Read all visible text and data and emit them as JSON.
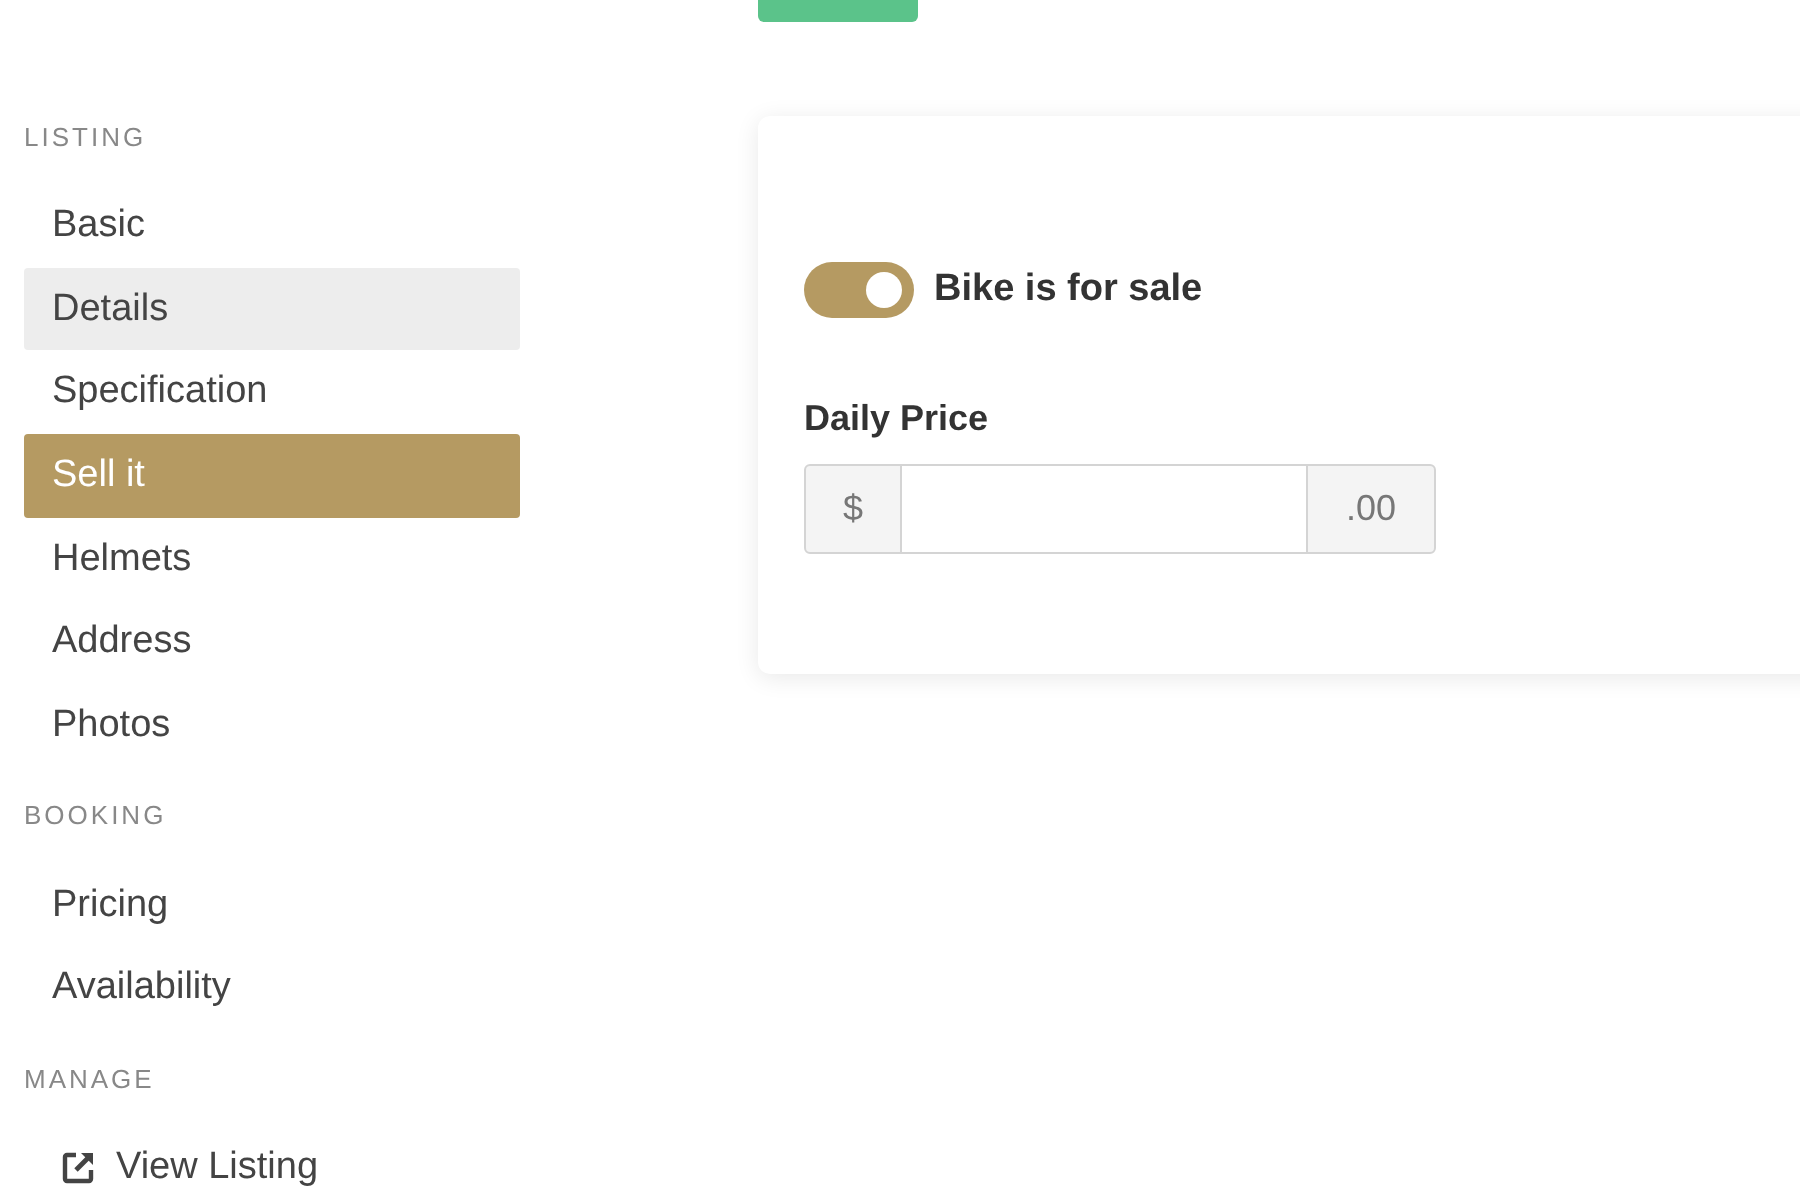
{
  "sidebar": {
    "sections": [
      {
        "heading": "LISTING",
        "items": [
          {
            "kind": "nav",
            "label": "Basic",
            "selected": false,
            "hovered": false
          },
          {
            "kind": "nav",
            "label": "Details",
            "selected": false,
            "hovered": true
          },
          {
            "kind": "nav",
            "label": "Specification",
            "selected": false,
            "hovered": false
          },
          {
            "kind": "nav",
            "label": "Sell it",
            "selected": true,
            "hovered": false
          },
          {
            "kind": "nav",
            "label": "Helmets",
            "selected": false,
            "hovered": false
          },
          {
            "kind": "nav",
            "label": "Address",
            "selected": false,
            "hovered": false
          },
          {
            "kind": "nav",
            "label": "Photos",
            "selected": false,
            "hovered": false
          }
        ]
      },
      {
        "heading": "BOOKING",
        "items": [
          {
            "kind": "nav",
            "label": "Pricing",
            "selected": false,
            "hovered": false
          },
          {
            "kind": "nav",
            "label": "Availability",
            "selected": false,
            "hovered": false
          }
        ]
      },
      {
        "heading": "MANAGE",
        "items": [
          {
            "kind": "link",
            "label": "View Listing",
            "selected": false,
            "hovered": false
          }
        ]
      }
    ]
  },
  "card": {
    "toggle": {
      "label": "Bike is for sale",
      "on": true
    },
    "price_field": {
      "label": "Daily Price",
      "prefix": "$",
      "suffix": ".00"
    }
  }
}
